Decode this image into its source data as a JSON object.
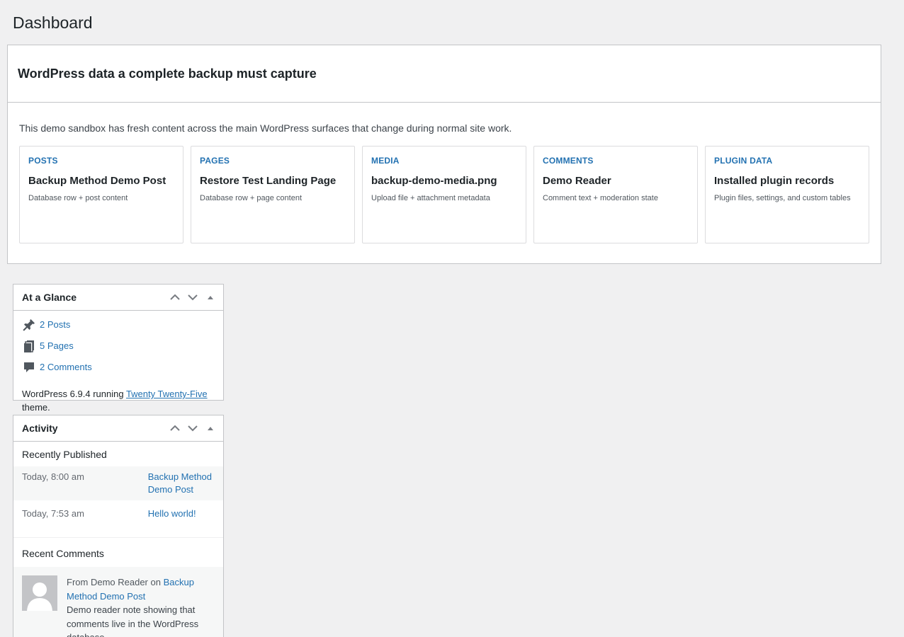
{
  "page": {
    "title": "Dashboard"
  },
  "backup": {
    "heading": "WordPress data a complete backup must capture",
    "intro": "This demo sandbox has fresh content across the main WordPress surfaces that change during normal site work.",
    "cards": [
      {
        "kicker": "POSTS",
        "title": "Backup Method Demo Post",
        "desc": "Database row + post content"
      },
      {
        "kicker": "PAGES",
        "title": "Restore Test Landing Page",
        "desc": "Database row + page content"
      },
      {
        "kicker": "MEDIA",
        "title": "backup-demo-media.png",
        "desc": "Upload file + attachment metadata"
      },
      {
        "kicker": "COMMENTS",
        "title": "Demo Reader",
        "desc": "Comment text + moderation state"
      },
      {
        "kicker": "PLUGIN DATA",
        "title": "Installed plugin records",
        "desc": "Plugin files, settings, and custom tables"
      }
    ]
  },
  "glance": {
    "title": "At a Glance",
    "posts": "2 Posts",
    "pages": "5 Pages",
    "comments": "2 Comments",
    "version_prefix": "WordPress 6.9.4 running ",
    "theme": "Twenty Twenty-Five",
    "version_suffix": " theme."
  },
  "activity": {
    "title": "Activity",
    "recently_published_label": "Recently Published",
    "published": [
      {
        "date": "Today, 8:00 am",
        "title": "Backup Method Demo Post"
      },
      {
        "date": "Today, 7:53 am",
        "title": "Hello world!"
      }
    ],
    "recent_comments_label": "Recent Comments",
    "comment": {
      "from_prefix": "From ",
      "author": "Demo Reader",
      "on_word": " on ",
      "post": "Backup Method Demo Post",
      "text": "Demo reader note showing that comments live in the WordPress database."
    }
  },
  "icons": {
    "move_up": "chevron-up-icon",
    "move_down": "chevron-down-icon",
    "toggle": "caret-up-icon",
    "post": "pushpin-icon",
    "page": "pages-icon",
    "comment": "comment-bubble-icon",
    "avatar": "user-silhouette-icon"
  },
  "colors": {
    "link": "#2271b1",
    "background": "#f0f0f1",
    "border": "#c3c4c7"
  }
}
